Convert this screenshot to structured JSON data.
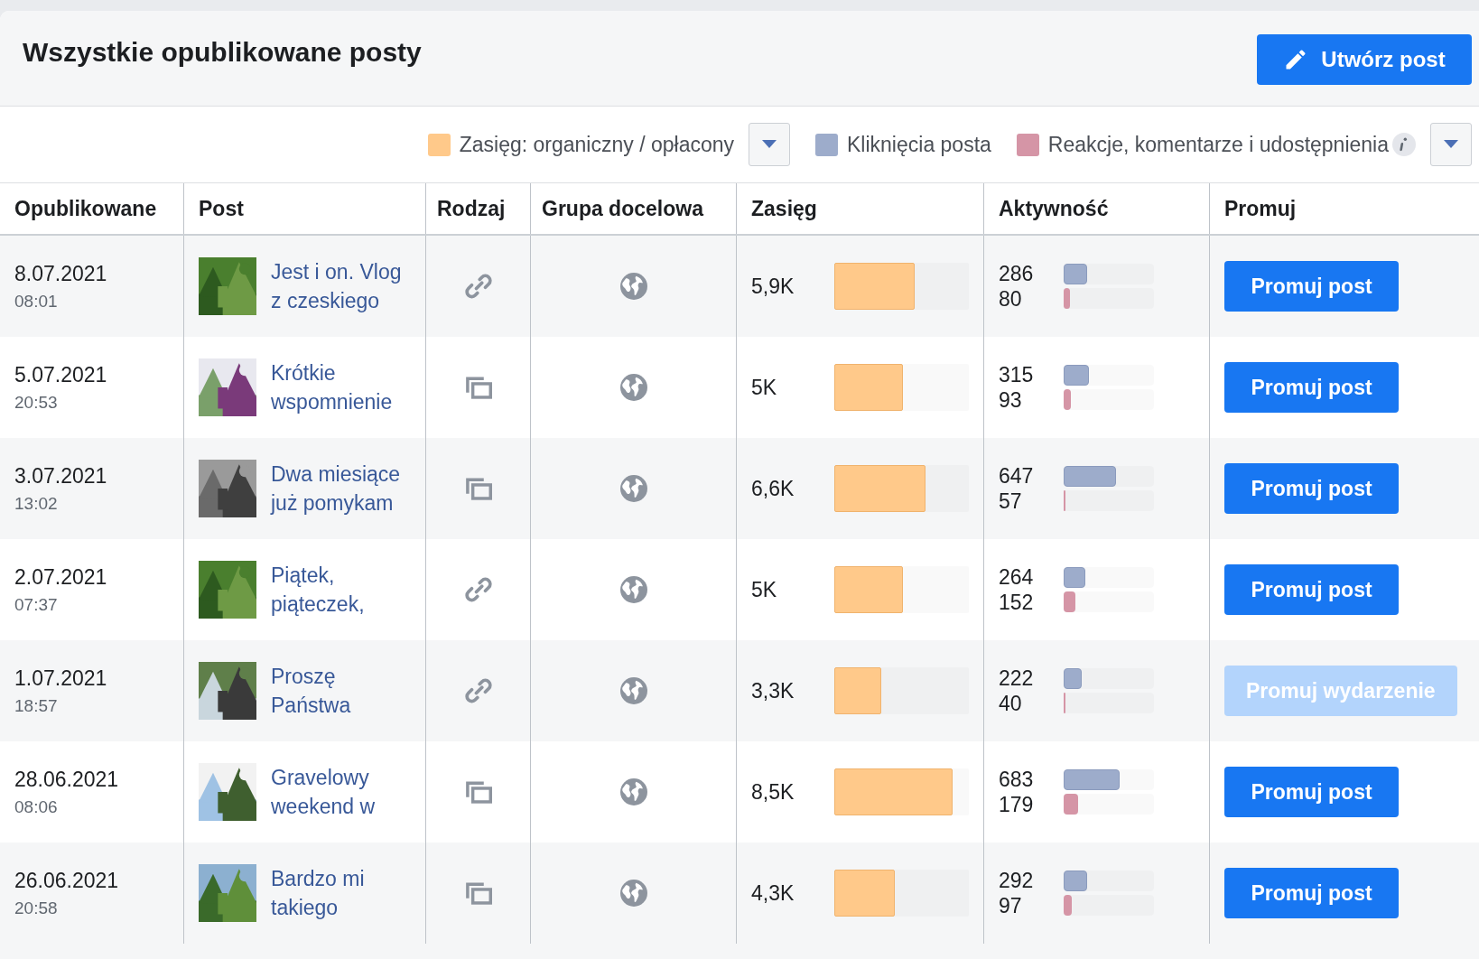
{
  "header": {
    "title": "Wszystkie opublikowane posty",
    "create_button": "Utwórz post"
  },
  "legend": [
    {
      "label": "Zasięg: organiczny / opłacony",
      "color": "#ffc98a",
      "dropdown": true,
      "info": false
    },
    {
      "label": "Kliknięcia posta",
      "color": "#9daccb",
      "dropdown": false,
      "info": false
    },
    {
      "label": "Reakcje, komentarze i udostępnienia",
      "color": "#d595a6",
      "dropdown": true,
      "info": true
    }
  ],
  "table": {
    "columns": [
      "Opublikowane",
      "Post",
      "Rodzaj",
      "Grupa docelowa",
      "Zasięg",
      "Aktywność",
      "Promuj"
    ],
    "rows": [
      {
        "date": "8.07.2021",
        "time": "08:01",
        "title": "Jest i on. Vlog z czeskiego",
        "kind": "link",
        "reach": "5,9K",
        "reach_bar": {
          "level": 0.6
        },
        "clicks": "286",
        "clicks_bar": {
          "level": 0.26
        },
        "reactions": "80",
        "reactions_bar": {
          "level": 0.07
        },
        "promote": {
          "label": "Promuj post",
          "disabled": false
        }
      },
      {
        "date": "5.07.2021",
        "time": "20:53",
        "title": "Krótkie wspomnienie",
        "kind": "album",
        "reach": "5K",
        "reach_bar": {
          "level": 0.51
        },
        "clicks": "315",
        "clicks_bar": {
          "level": 0.28
        },
        "reactions": "93",
        "reactions_bar": {
          "level": 0.08
        },
        "promote": {
          "label": "Promuj post",
          "disabled": false
        }
      },
      {
        "date": "3.07.2021",
        "time": "13:02",
        "title": "Dwa miesiące już pomykam",
        "kind": "album",
        "reach": "6,6K",
        "reach_bar": {
          "level": 0.68
        },
        "clicks": "647",
        "clicks_bar": {
          "level": 0.58
        },
        "reactions": "57",
        "reactions_bar": {
          "level": 0.02
        },
        "promote": {
          "label": "Promuj post",
          "disabled": false
        }
      },
      {
        "date": "2.07.2021",
        "time": "07:37",
        "title": "Piątek, piąteczek,",
        "kind": "link",
        "reach": "5K",
        "reach_bar": {
          "level": 0.51
        },
        "clicks": "264",
        "clicks_bar": {
          "level": 0.24
        },
        "reactions": "152",
        "reactions_bar": {
          "level": 0.13
        },
        "promote": {
          "label": "Promuj post",
          "disabled": false
        }
      },
      {
        "date": "1.07.2021",
        "time": "18:57",
        "title": "Proszę Państwa",
        "kind": "link",
        "reach": "3,3K",
        "reach_bar": {
          "level": 0.35
        },
        "clicks": "222",
        "clicks_bar": {
          "level": 0.2
        },
        "reactions": "40",
        "reactions_bar": {
          "level": 0.02
        },
        "promote": {
          "label": "Promuj wydarzenie",
          "disabled": true
        }
      },
      {
        "date": "28.06.2021",
        "time": "08:06",
        "title": "Gravelowy weekend w",
        "kind": "album",
        "reach": "8,5K",
        "reach_bar": {
          "level": 0.88
        },
        "clicks": "683",
        "clicks_bar": {
          "level": 0.62
        },
        "reactions": "179",
        "reactions_bar": {
          "level": 0.16
        },
        "promote": {
          "label": "Promuj post",
          "disabled": false
        }
      },
      {
        "date": "26.06.2021",
        "time": "20:58",
        "title": "Bardzo mi takiego",
        "kind": "album",
        "reach": "4,3K",
        "reach_bar": {
          "level": 0.45
        },
        "clicks": "292",
        "clicks_bar": {
          "level": 0.26
        },
        "reactions": "97",
        "reactions_bar": {
          "level": 0.09
        },
        "promote": {
          "label": "Promuj post",
          "disabled": false
        }
      }
    ]
  }
}
